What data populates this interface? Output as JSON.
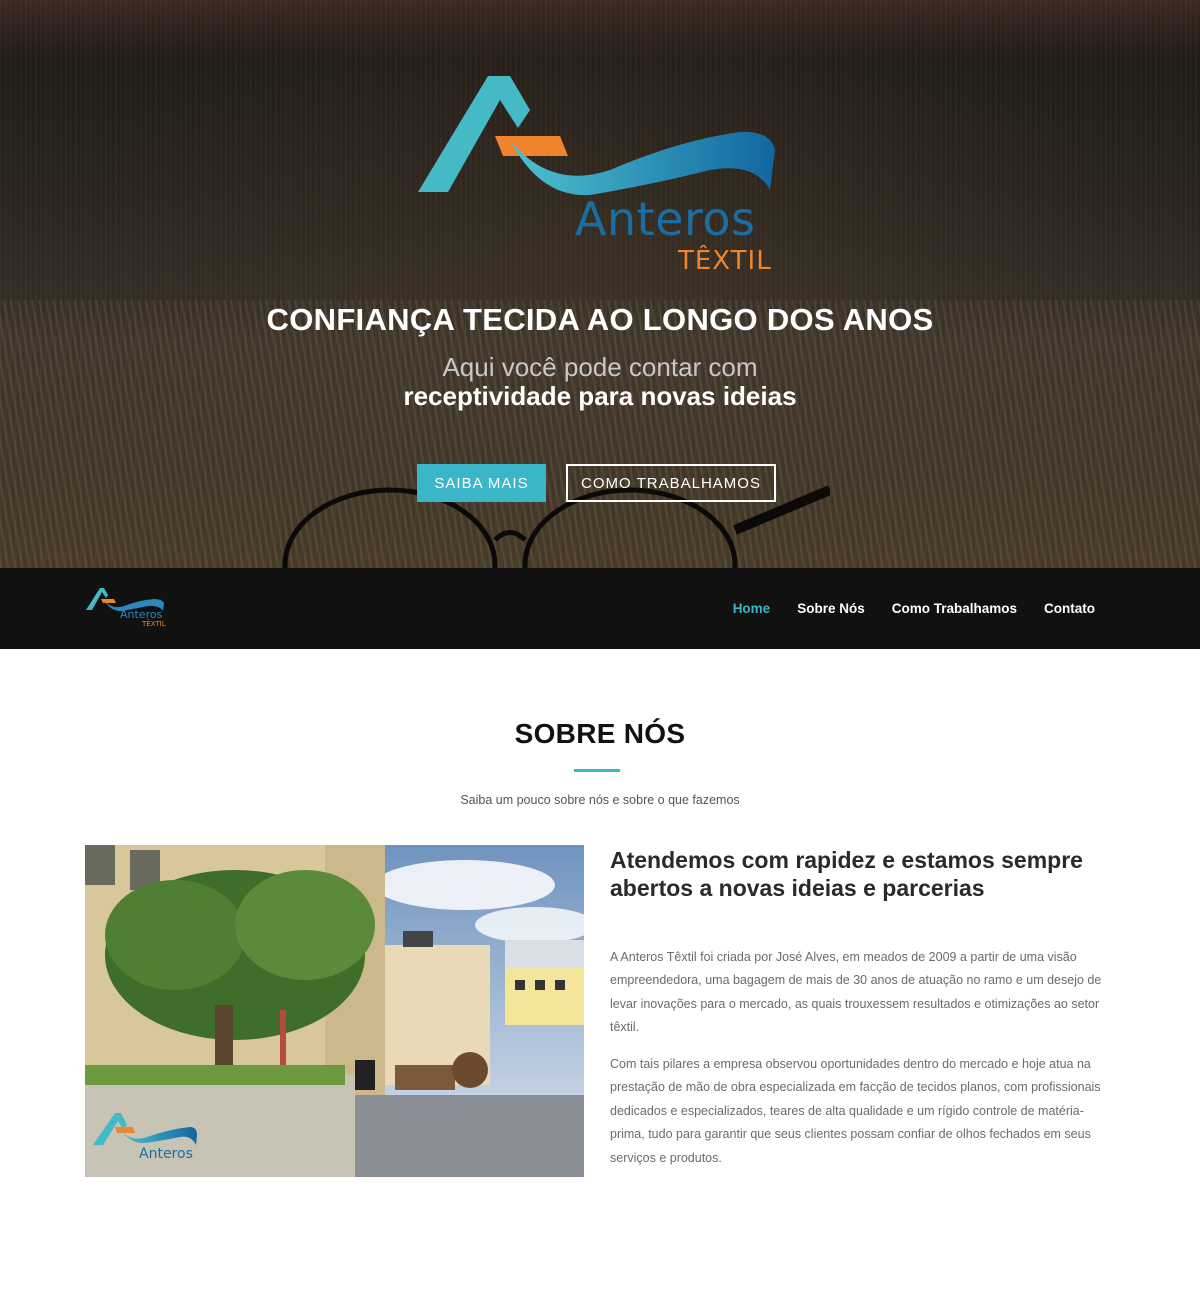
{
  "hero": {
    "logo": {
      "brand": "Anteros",
      "sub": "TÊXTIL"
    },
    "title": "CONFIANÇA TECIDA AO LONGO DOS ANOS",
    "subtitle_line1": "Aqui você pode contar com",
    "subtitle_line2": "receptividade para novas ideias",
    "primary_button": "SAIBA MAIS",
    "secondary_button": "COMO TRABALHAMOS"
  },
  "nav": {
    "logo": {
      "brand": "Anteros",
      "sub": "TÊXTIL"
    },
    "items": [
      {
        "label": "Home",
        "active": true
      },
      {
        "label": "Sobre Nós"
      },
      {
        "label": "Como Trabalhamos"
      },
      {
        "label": "Contato"
      }
    ]
  },
  "about": {
    "title": "SOBRE NÓS",
    "lead": "Saiba um pouco sobre nós e sobre o que fazemos",
    "photo_watermark": "Anteros",
    "heading": "Atendemos com rapidez e estamos sempre abertos a novas ideias e parcerias",
    "paragraph1": "A Anteros Têxtil foi criada por José Alves, em meados de 2009 a partir de uma visão empreendedora, uma bagagem de mais de 30 anos de atuação no ramo e um desejo de levar inovações para o mercado, as quais trouxessem resultados e otimizações ao setor têxtil.",
    "paragraph2": "Com tais pilares a empresa observou oportunidades dentro do mercado e hoje atua na prestação de mão de obra especializada em facção de tecidos planos, com profissionais dedicados e especializados, teares de alta qualidade e um rígido controle de matéria-prima, tudo para garantir que seus clientes possam confiar de olhos fechados em seus serviços e produtos."
  },
  "colors": {
    "accent": "#3bb5c8",
    "logo_blue": "#1b6ea3",
    "logo_orange": "#f0842d",
    "nav_bg": "#111111"
  }
}
